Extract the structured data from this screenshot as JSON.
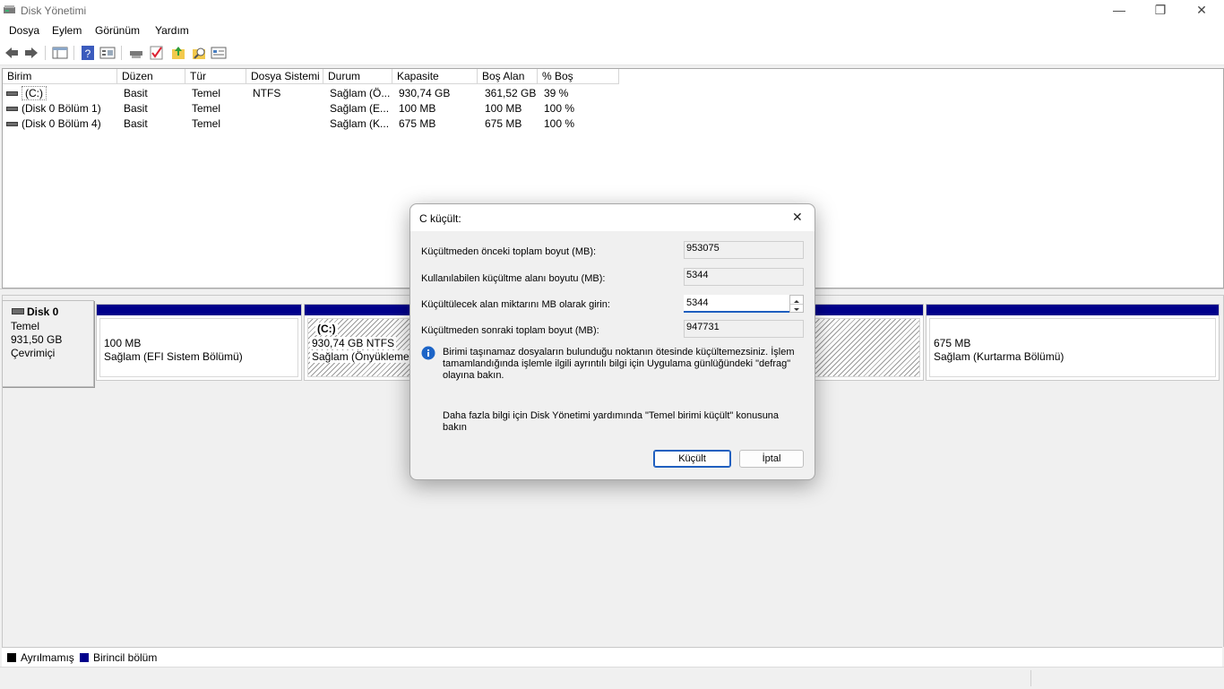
{
  "window": {
    "title": "Disk Yönetimi",
    "controls": {
      "minimize": "—",
      "restore": "❐",
      "close": "✕"
    }
  },
  "menu": [
    "Dosya",
    "Eylem",
    "Görünüm",
    "Yardım"
  ],
  "toolbar_icons": [
    "back-arrow-icon",
    "forward-arrow-icon",
    "console-tree-icon",
    "help-icon",
    "properties-icon",
    "connect-icon",
    "check-icon",
    "up-icon",
    "search-icon",
    "view-icon"
  ],
  "list": {
    "columns": [
      "Birim",
      "Düzen",
      "Tür",
      "Dosya Sistemi",
      "Durum",
      "Kapasite",
      "Boş Alan",
      "% Boş"
    ],
    "rows": [
      [
        "(C:)",
        "Basit",
        "Temel",
        "NTFS",
        "Sağlam (Ö...",
        "930,74 GB",
        "361,52 GB",
        "39 %"
      ],
      [
        "(Disk 0 Bölüm 1)",
        "Basit",
        "Temel",
        "",
        "Sağlam (E...",
        "100 MB",
        "100 MB",
        "100 %"
      ],
      [
        "(Disk 0 Bölüm 4)",
        "Basit",
        "Temel",
        "",
        "Sağlam (K...",
        "675 MB",
        "675 MB",
        "100 %"
      ]
    ]
  },
  "disk": {
    "name": "Disk 0",
    "type": "Temel",
    "size": "931,50 GB",
    "status": "Çevrimiçi",
    "partitions": [
      {
        "name": "",
        "size": "100 MB",
        "status": "Sağlam (EFI Sistem Bölümü)"
      },
      {
        "name": "(C:)",
        "size": "930,74 GB NTFS",
        "status": "Sağlam (Önyükleme,"
      },
      {
        "name": "",
        "size": "675 MB",
        "status": "Sağlam (Kurtarma Bölümü)"
      }
    ]
  },
  "legend": [
    {
      "label": "Ayrılmamış",
      "color": "#000000"
    },
    {
      "label": "Birincil bölüm",
      "color": "#00008b"
    }
  ],
  "dialog": {
    "title": "C küçült:",
    "close": "✕",
    "total_before_label": "Küçültmeden önceki toplam boyut (MB):",
    "total_before_value": "953075",
    "available_label": "Kullanılabilen küçültme alanı boyutu (MB):",
    "available_value": "5344",
    "amount_label": "Küçültülecek alan miktarını MB olarak girin:",
    "amount_value": "5344",
    "total_after_label": "Küçültmeden sonraki toplam boyut (MB):",
    "total_after_value": "947731",
    "info_text": "Birimi taşınamaz dosyaların bulunduğu noktanın ötesinde küçültemezsiniz. İşlem tamamlandığında işlemle ilgili ayrıntılı bilgi için Uygulama günlüğündeki \"defrag\" olayına bakın.",
    "help_text": "Daha fazla bilgi için Disk Yönetimi yardımında \"Temel birimi küçült\" konusuna bakın",
    "shrink_button": "Küçült",
    "cancel_button": "İptal"
  }
}
